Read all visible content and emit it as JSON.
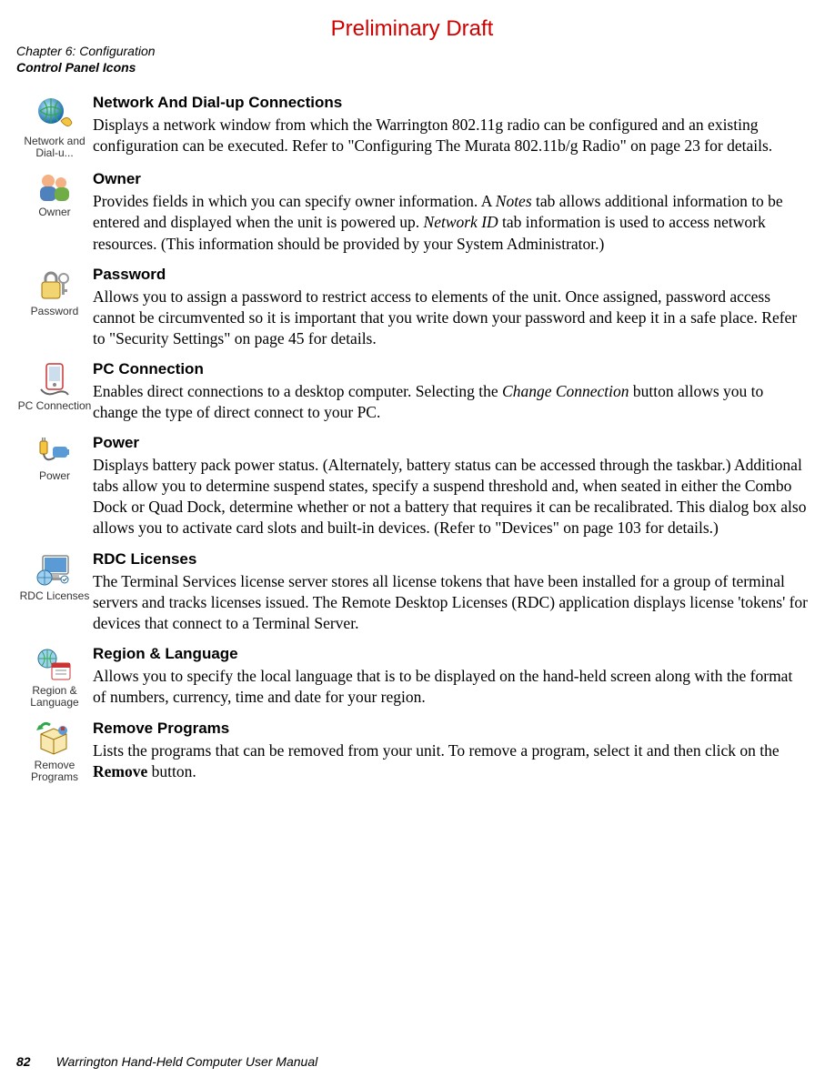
{
  "draft": "Preliminary Draft",
  "header": {
    "line1": "Chapter 6: Configuration",
    "line2": "Control Panel Icons"
  },
  "sections": [
    {
      "icon_caption": "Network and Dial-u...",
      "title": "Network And Dial-up Connections",
      "body_html": "Displays a network window from which the Warrington 802.11g radio can be configured and an existing configuration can be executed. Refer to \"Configuring The Murata 802.11b/g Radio\" on page 23 for details."
    },
    {
      "icon_caption": "Owner",
      "title": "Owner",
      "body_html": "Provides fields in which you can specify owner information. A <em>Notes</em> tab allows additional information to be entered and displayed when the unit is powered up. <em>Network ID</em> tab information is used to access network resources. (This information should be provided by your System Administrator.)"
    },
    {
      "icon_caption": "Password",
      "title": "Password",
      "body_html": "Allows you to assign a password to restrict access to elements of the unit. Once assigned, password access cannot be circumvented so it is important that you write down your password and keep it in a safe place. Refer to \"Security Settings\" on page 45 for details."
    },
    {
      "icon_caption": "PC Connection",
      "title": "PC Connection",
      "body_html": "Enables direct connections to a desktop computer. Selecting the <em>Change Connection</em> button allows you to change the type of direct connect to your PC."
    },
    {
      "icon_caption": "Power",
      "title": "Power",
      "body_html": "Displays battery pack power status. (Alternately, battery status can be accessed through the taskbar.) Additional tabs allow you to determine suspend states, specify a suspend threshold and, when seated in either the Combo Dock or Quad Dock, determine whether or not a battery that requires it can be recalibrated. This dialog box also allows you to activate card slots and built-in devices. (Refer to \"Devices\" on page 103 for details.)"
    },
    {
      "icon_caption": "RDC Licenses",
      "title": "RDC Licenses",
      "body_html": "The Terminal Services license server stores all license tokens that have been installed for a group of terminal servers and tracks licenses issued. The Remote Desktop Licenses (RDC) application displays license 'tokens' for devices that connect to a Terminal Server."
    },
    {
      "icon_caption": "Region & Language",
      "title": "Region & Language",
      "body_html": "Allows you to specify the local language that is to be displayed on the hand-held screen along with the format of numbers, currency, time and date for your region."
    },
    {
      "icon_caption": "Remove Programs",
      "title": "Remove Programs",
      "body_html": "Lists the programs that can be removed from your unit. To remove a program, select it and then click on the <strong>Remove</strong> button."
    }
  ],
  "footer": {
    "page": "82",
    "text": "Warrington Hand-Held Computer User Manual"
  }
}
